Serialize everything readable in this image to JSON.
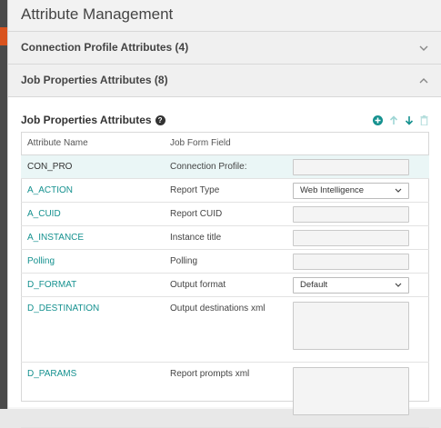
{
  "page": {
    "title": "Attribute Management"
  },
  "accordions": [
    {
      "label": "Connection Profile Attributes (4)",
      "expanded": false
    },
    {
      "label": "Job Properties Attributes (8)",
      "expanded": true
    }
  ],
  "job_props": {
    "title": "Job Properties Attributes",
    "help_glyph": "?",
    "columns": [
      "Attribute Name",
      "Job Form Field"
    ],
    "rows": [
      {
        "name": "CON_PRO",
        "field": "Connection Profile:",
        "control": "text",
        "value": ""
      },
      {
        "name": "A_ACTION",
        "field": "Report Type",
        "control": "select",
        "value": "Web Intelligence"
      },
      {
        "name": "A_CUID",
        "field": "Report CUID",
        "control": "text",
        "value": ""
      },
      {
        "name": "A_INSTANCE",
        "field": "Instance title",
        "control": "text",
        "value": ""
      },
      {
        "name": "Polling",
        "field": "Polling",
        "control": "text",
        "value": ""
      },
      {
        "name": "D_FORMAT",
        "field": "Output format",
        "control": "select",
        "value": "Default"
      },
      {
        "name": "D_DESTINATION",
        "field": "Output destinations xml",
        "control": "textarea",
        "value": ""
      },
      {
        "name": "D_PARAMS",
        "field": "Report prompts xml",
        "control": "textarea",
        "value": ""
      }
    ]
  },
  "colors": {
    "accent": "#15918f",
    "selected_row": "#eaf6f6"
  },
  "icons": [
    "chevron-down-icon",
    "chevron-up-icon",
    "help-icon",
    "add-icon",
    "arrow-up-icon",
    "arrow-down-icon",
    "trash-icon"
  ]
}
